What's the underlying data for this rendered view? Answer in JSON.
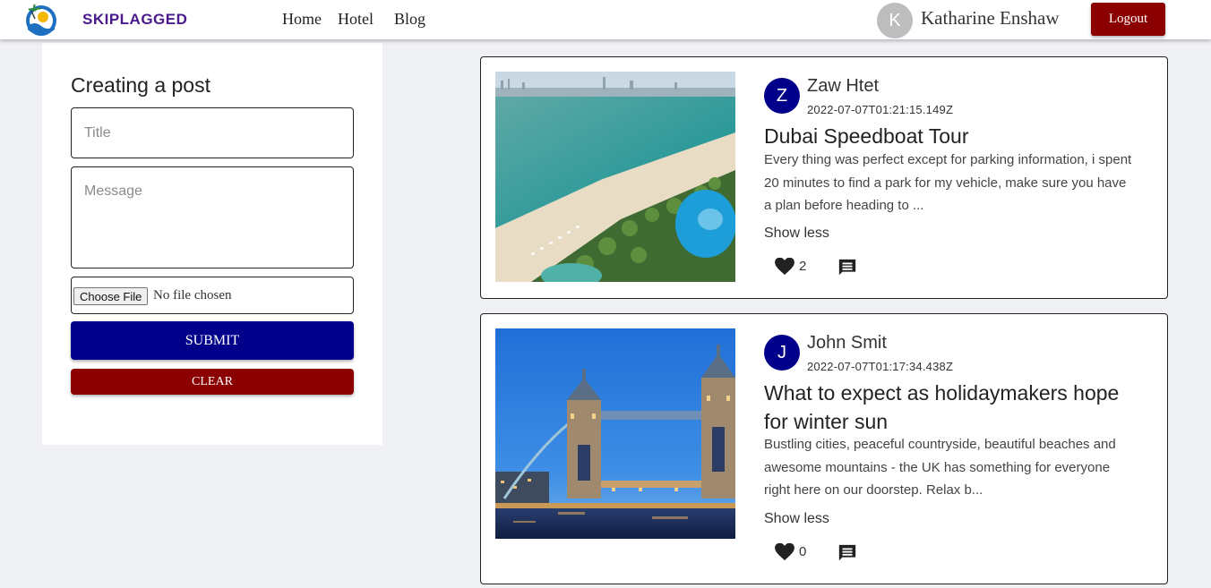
{
  "colors": {
    "brand_purple": "#4b1a8c",
    "submit_navy": "#00008b",
    "danger_red": "#8b0000",
    "page_bg": "#f0f1f5"
  },
  "navbar": {
    "brand": "SKIPLAGGED",
    "logo_icon": "globe-palm-logo-icon",
    "links": [
      "Home",
      "Hotel",
      "Blog"
    ],
    "user_initial": "K",
    "user_name": "Katharine Enshaw",
    "logout_label": "Logout"
  },
  "form": {
    "heading": "Creating a post",
    "title_placeholder": "Title",
    "message_placeholder": "Message",
    "choose_file_label": "Choose File",
    "file_status": "No file chosen",
    "submit_label": "SUBMIT",
    "clear_label": "CLEAR"
  },
  "posts": [
    {
      "author_initial": "Z",
      "author": "Zaw Htet",
      "date": "2022-07-07T01:21:15.149Z",
      "title": "Dubai Speedboat Tour",
      "body": "Every thing was perfect except for parking information, i spent 20 minutes to find a park for my vehicle, make sure you have a plan before heading to ...",
      "toggle_label": "Show less",
      "likes": "2",
      "image": "dubai-beach-resort-photo",
      "like_icon": "heart-icon",
      "comment_icon": "comment-icon"
    },
    {
      "author_initial": "J",
      "author": "John Smit",
      "date": "2022-07-07T01:17:34.438Z",
      "title": "What to expect as holidaymakers hope for winter sun",
      "body": "Bustling cities, peaceful countryside, beautiful beaches and awesome mountains - the UK has something for everyone right here on our doorstep. Relax b...",
      "toggle_label": "Show less",
      "likes": "0",
      "image": "tower-bridge-photo",
      "like_icon": "heart-icon",
      "comment_icon": "comment-icon"
    }
  ]
}
